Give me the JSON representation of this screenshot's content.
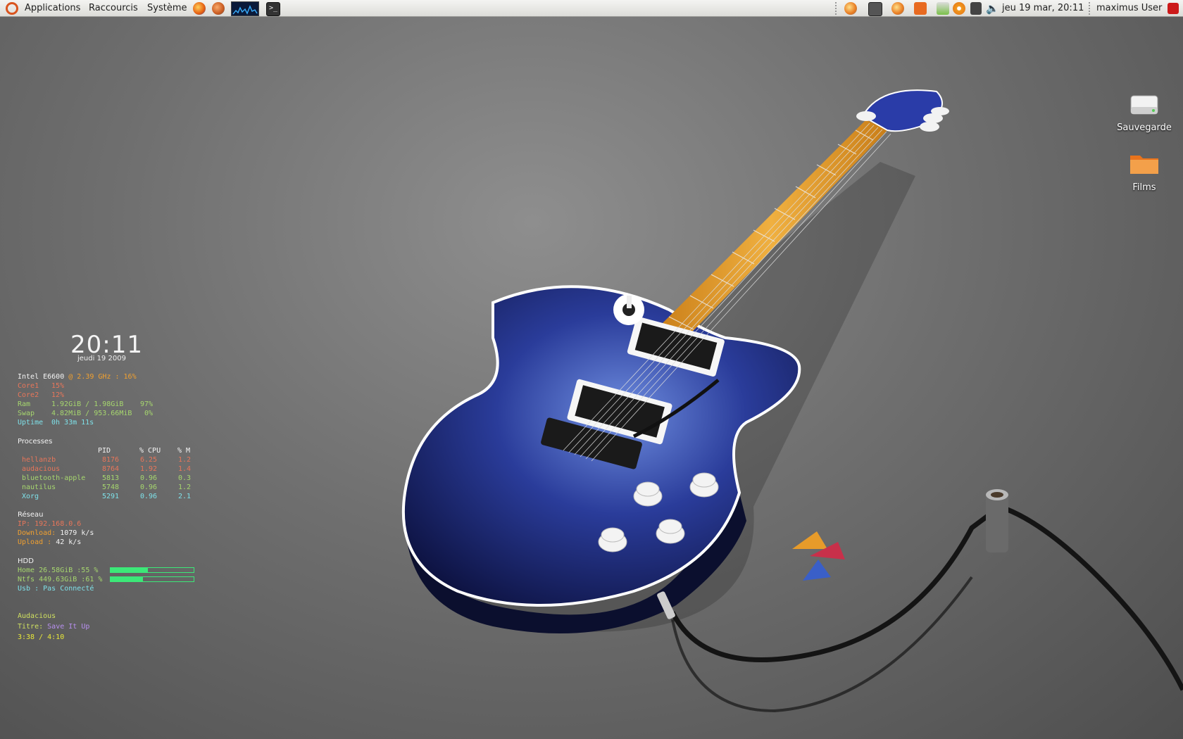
{
  "panel": {
    "menus": [
      "Applications",
      "Raccourcis",
      "Système"
    ],
    "clock": "jeu 19 mar, 20:11",
    "user": "maximus User"
  },
  "desktop_icons": [
    {
      "label": "Sauvegarde",
      "icon": "drive-icon"
    },
    {
      "label": "Films",
      "icon": "folder-icon"
    }
  ],
  "conky": {
    "time": "20:11",
    "date": "jeudi 19 2009",
    "cpu": {
      "name": "Intel E6600",
      "freq": "@ 2.39 GHz : 16%"
    },
    "core1": {
      "label": "Core1",
      "value": "15%"
    },
    "core2": {
      "label": "Core2",
      "value": "12%"
    },
    "ram": {
      "label": "Ram",
      "value": "1.92GiB / 1.98GiB",
      "pct": "97%"
    },
    "swap": {
      "label": "Swap",
      "value": "4.82MiB / 953.66MiB",
      "pct": "0%"
    },
    "uptime": {
      "label": "Uptime",
      "value": "0h 33m 11s"
    },
    "processes_title": "Processes",
    "proc_headers": [
      "PID",
      "% CPU",
      "% M"
    ],
    "processes": [
      {
        "name": "hellanzb",
        "pid": "8176",
        "cpu": "6.25",
        "mem": "1.2"
      },
      {
        "name": "audacious",
        "pid": "8764",
        "cpu": "1.92",
        "mem": "1.4"
      },
      {
        "name": "bluetooth-apple",
        "pid": "5813",
        "cpu": "0.96",
        "mem": "0.3"
      },
      {
        "name": "nautilus",
        "pid": "5748",
        "cpu": "0.96",
        "mem": "1.2"
      },
      {
        "name": "Xorg",
        "pid": "5291",
        "cpu": "0.96",
        "mem": "2.1"
      }
    ],
    "network_title": "Réseau",
    "ip": "IP: 192.168.0.6",
    "download": {
      "label": "Download:",
      "value": "1079 k/s"
    },
    "upload": {
      "label": "Upload  :",
      "value": "42 k/s"
    },
    "hdd_title": "HDD",
    "home": {
      "label": "Home  26.58GiB :55  %",
      "fill": 0.45
    },
    "ntfs": {
      "label": "Ntfs 449.63GiB :61  %",
      "fill": 0.39
    },
    "usb": {
      "label": "Usb    :",
      "value": "Pas Connecté"
    },
    "audacious_title": "Audacious",
    "title_label": "Titre:",
    "title_value": "Save It Up",
    "position": "3:38 / 4:10"
  },
  "colors": {
    "guitar_body": "#2a3c9a",
    "conky_accent": "#3ce878"
  }
}
